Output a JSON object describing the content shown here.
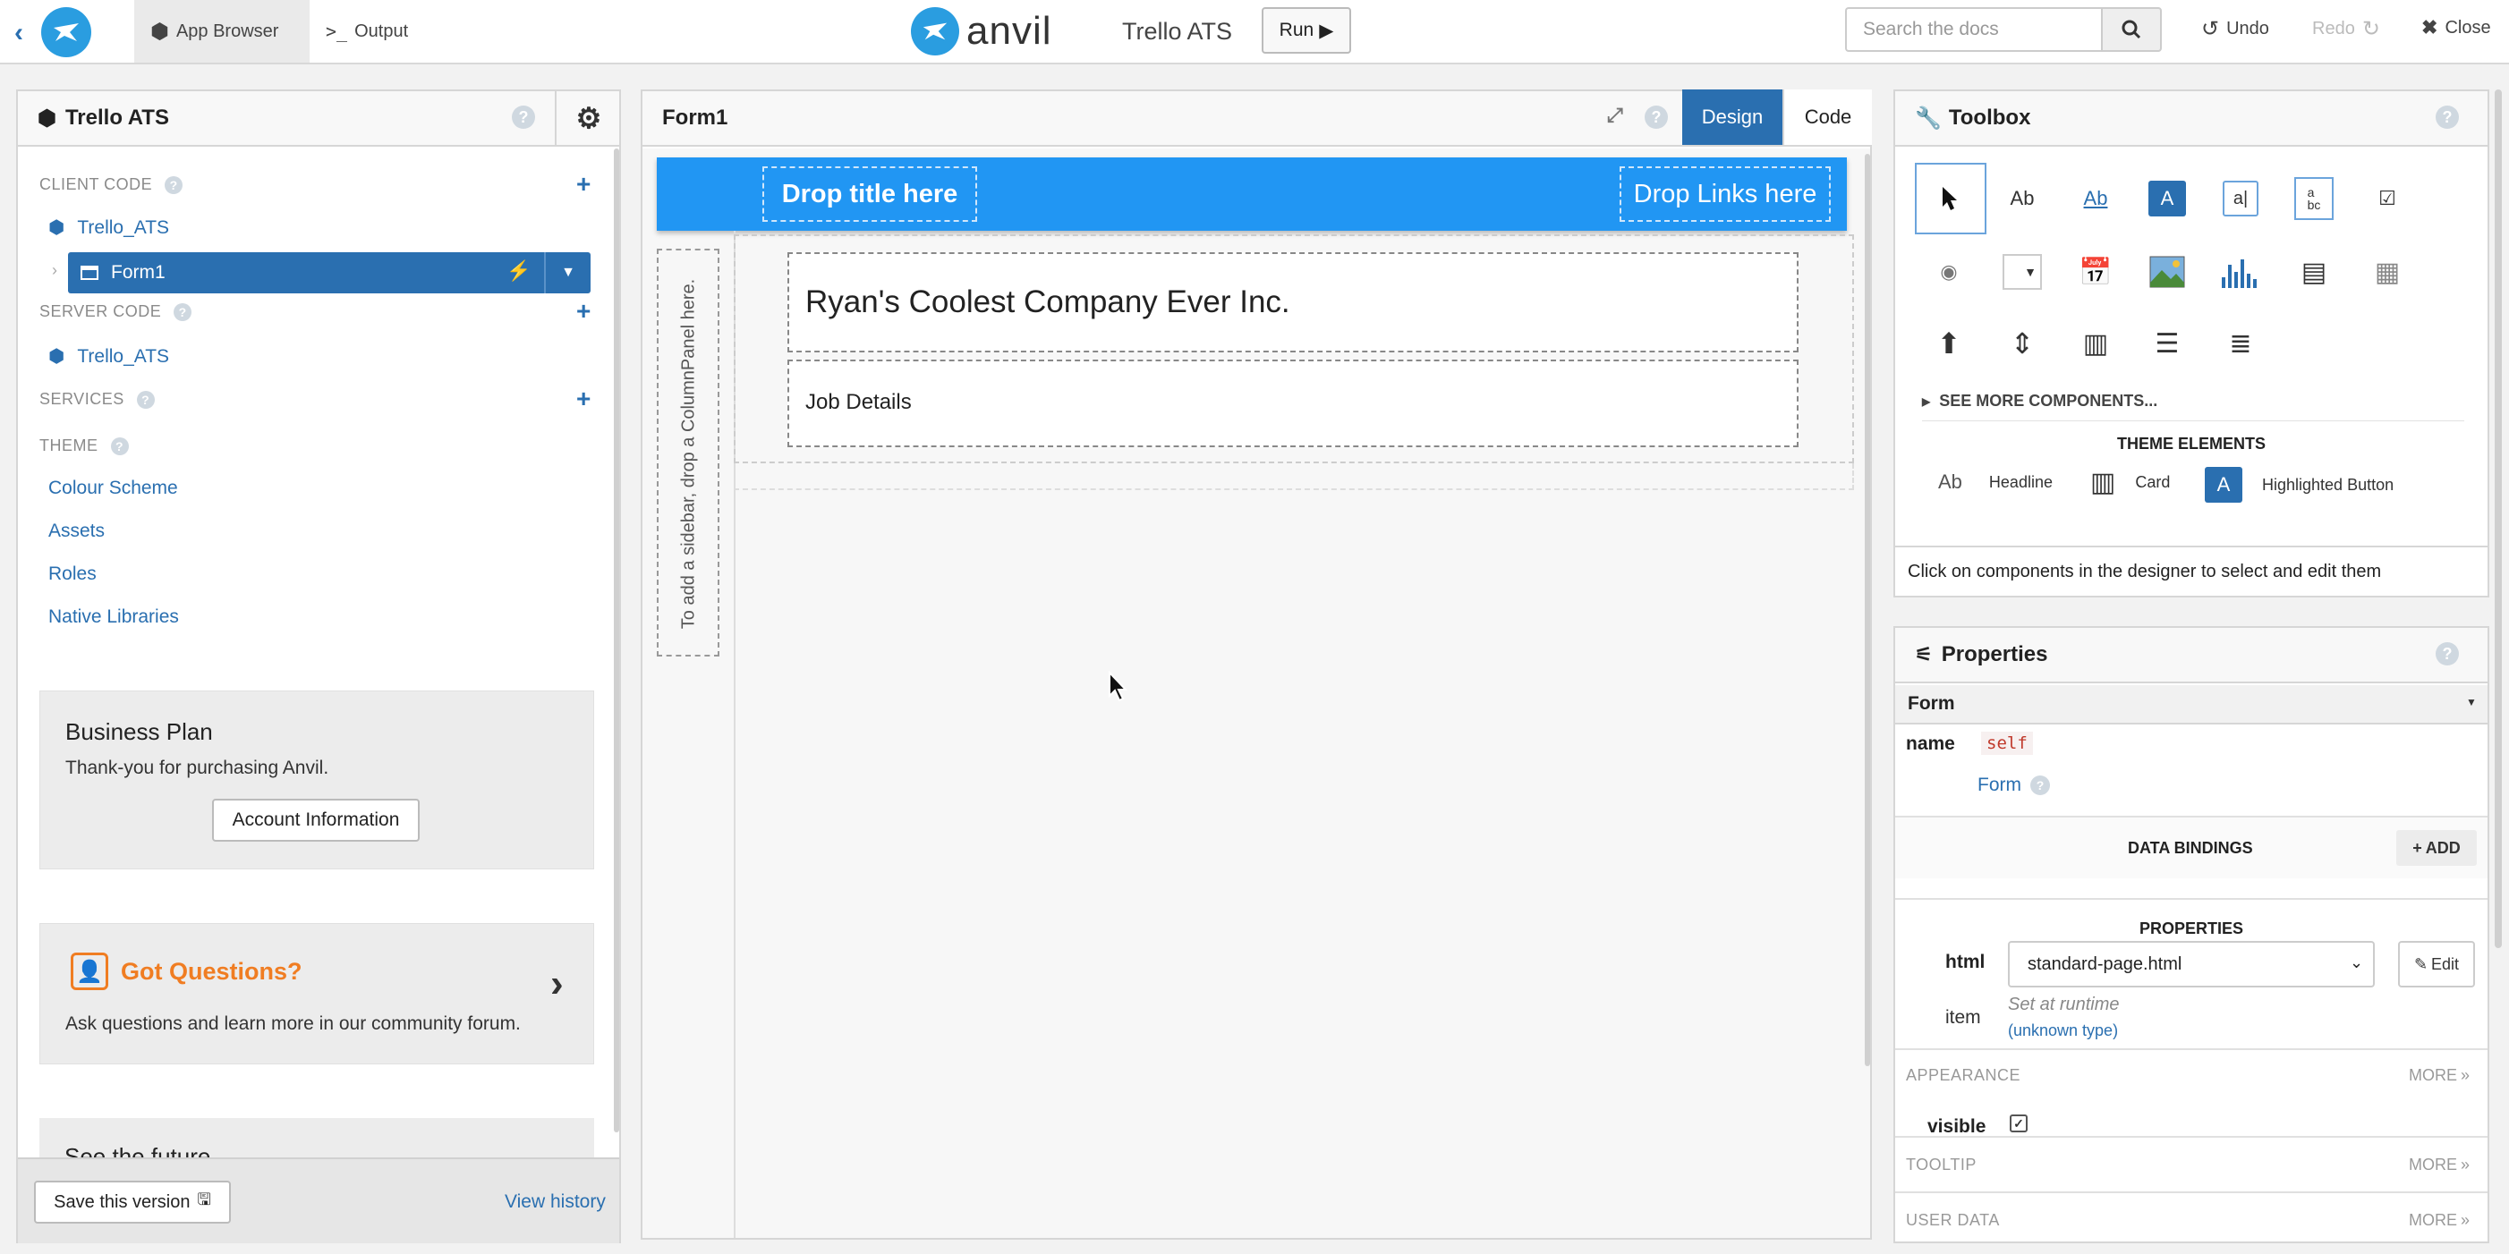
{
  "topbar": {
    "app_browser": "App Browser",
    "output": "Output",
    "brand": "anvil",
    "app_name": "Trello ATS",
    "run": "Run",
    "search_placeholder": "Search the docs",
    "undo": "Undo",
    "redo": "Redo",
    "close": "Close"
  },
  "left": {
    "title": "Trello ATS",
    "client_code": "CLIENT CODE",
    "client_module": "Trello_ATS",
    "form1": "Form1",
    "server_code": "SERVER CODE",
    "server_module": "Trello_ATS",
    "services": "SERVICES",
    "theme": "THEME",
    "theme_items": [
      "Colour Scheme",
      "Assets",
      "Roles",
      "Native Libraries"
    ],
    "plan_title": "Business Plan",
    "plan_text": "Thank-you for purchasing Anvil.",
    "account_btn": "Account Information",
    "questions_title": "Got Questions?",
    "questions_text": "Ask questions and learn more in our community forum.",
    "future_title": "See the future",
    "save_version": "Save this version",
    "view_history": "View history"
  },
  "center": {
    "title": "Form1",
    "design_tab": "Design",
    "code_tab": "Code",
    "drop_title": "Drop title here",
    "drop_links": "Drop Links here",
    "sidebar_hint": "To add a sidebar, drop a ColumnPanel here.",
    "company": "Ryan's Coolest Company Ever Inc.",
    "job_details": "Job Details"
  },
  "toolbox": {
    "title": "Toolbox",
    "see_more": "SEE MORE COMPONENTS...",
    "theme_elements": "THEME ELEMENTS",
    "theme": [
      {
        "icon": "Ab",
        "label": "Headline"
      },
      {
        "icon": "card",
        "label": "Card"
      },
      {
        "icon": "A",
        "label": "Highlighted Button"
      }
    ],
    "hint": "Click on components in the designer to select and edit them"
  },
  "properties": {
    "title": "Properties",
    "selected": "Form",
    "name_label": "name",
    "name_value": "self",
    "form_link": "Form",
    "data_bindings": "DATA BINDINGS",
    "add": "ADD",
    "properties_label": "PROPERTIES",
    "html_label": "html",
    "html_value": "standard-page.html",
    "edit": "Edit",
    "item_label": "item",
    "item_value": "Set at runtime",
    "item_type": "(unknown type)",
    "appearance": "APPEARANCE",
    "more": "MORE",
    "visible_label": "visible",
    "tooltip": "TOOLTIP",
    "user_data": "USER DATA"
  },
  "colors": {
    "accent": "#2a6fb0",
    "title_bar": "#2196f3",
    "orange": "#f07d22"
  }
}
